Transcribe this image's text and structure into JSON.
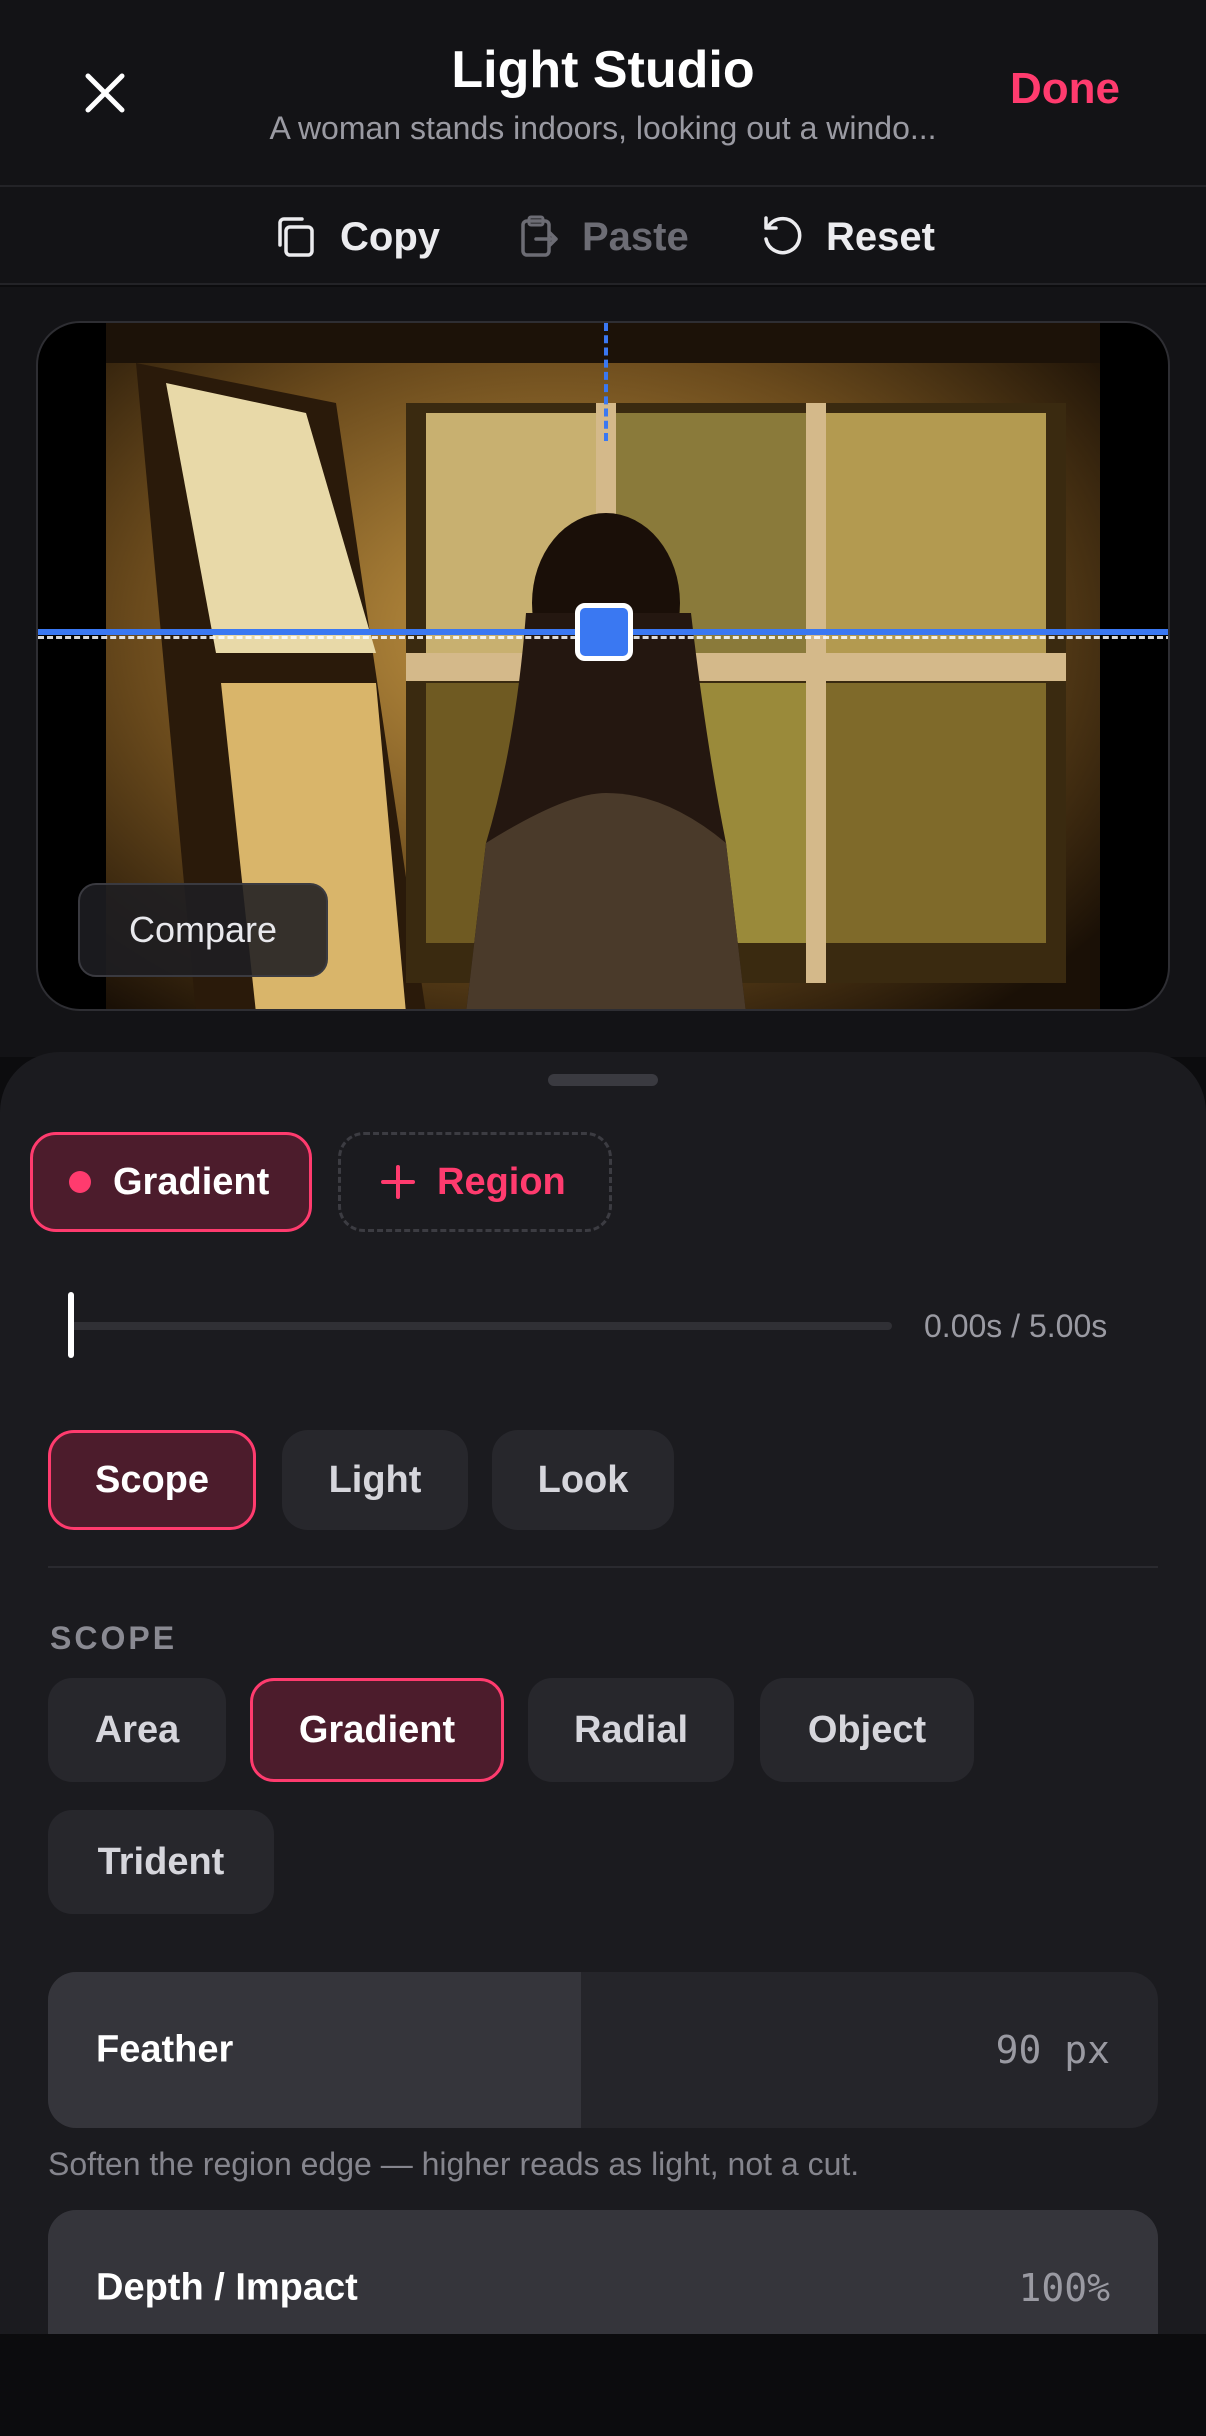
{
  "header": {
    "title": "Light Studio",
    "subtitle": "A woman stands indoors, looking out a windo...",
    "done_label": "Done"
  },
  "toolbar": {
    "copy_label": "Copy",
    "paste_label": "Paste",
    "reset_label": "Reset"
  },
  "preview": {
    "compare_label": "Compare"
  },
  "regions": {
    "active_label": "Gradient",
    "add_label": "Region"
  },
  "timeline": {
    "readout": "0.00s / 5.00s",
    "position_fraction": 0.0
  },
  "tabs": [
    {
      "label": "Scope",
      "active": true
    },
    {
      "label": "Light",
      "active": false
    },
    {
      "label": "Look",
      "active": false
    }
  ],
  "scope": {
    "section_label": "SCOPE",
    "options": [
      "Area",
      "Gradient",
      "Radial",
      "Object",
      "Trident"
    ],
    "selected": "Gradient"
  },
  "controls": {
    "feather": {
      "label": "Feather",
      "value": "90 px",
      "level_fraction": 0.48
    },
    "feather_hint": "Soften the region edge — higher reads as light, not a cut.",
    "depth": {
      "label": "Depth / Impact",
      "value": "100%",
      "level_fraction": 1.0
    }
  },
  "colors": {
    "accent": "#ff3b6e",
    "guide": "#3a78f2"
  }
}
